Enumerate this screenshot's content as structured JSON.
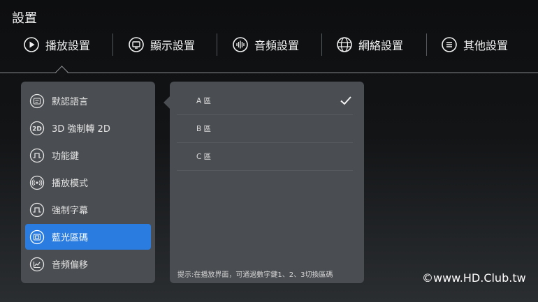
{
  "header": {
    "title": "設置"
  },
  "tabs": [
    {
      "label": "播放設置",
      "icon": "play-icon"
    },
    {
      "label": "顯示設置",
      "icon": "monitor-icon"
    },
    {
      "label": "音頻設置",
      "icon": "audio-wave-icon"
    },
    {
      "label": "網絡設置",
      "icon": "globe-icon"
    },
    {
      "label": "其他設置",
      "icon": "menu-list-icon"
    }
  ],
  "sidebar": {
    "items": [
      {
        "label": "默認語言",
        "icon": "language-icon"
      },
      {
        "label": "3D 強制轉 2D",
        "icon": "2d-icon"
      },
      {
        "label": "功能鍵",
        "icon": "pulse-icon"
      },
      {
        "label": "播放模式",
        "icon": "broadcast-icon"
      },
      {
        "label": "強制字幕",
        "icon": "subtitle-icon"
      },
      {
        "label": "藍光區碼",
        "icon": "bluray-region-icon",
        "selected": true
      },
      {
        "label": "音頻偏移",
        "icon": "chart-icon"
      }
    ]
  },
  "panel": {
    "options": [
      {
        "label": "A 區",
        "checked": true
      },
      {
        "label": "B 區",
        "checked": false
      },
      {
        "label": "C 區",
        "checked": false
      }
    ],
    "hint": "提示:在播放界面，可通過數字鍵1、2、3切換區碼"
  },
  "watermark": "©www.HD.Club.tw",
  "colors": {
    "accent": "#2a7ce0",
    "panel": "#4a4d51"
  }
}
